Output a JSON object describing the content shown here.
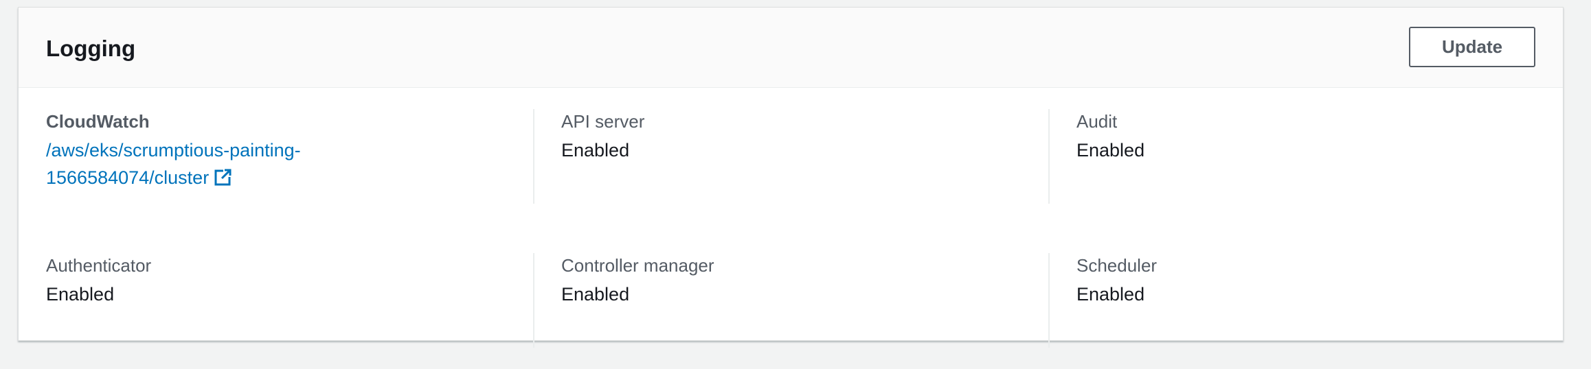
{
  "panel": {
    "title": "Logging",
    "update_label": "Update"
  },
  "colors": {
    "link": "#0073bb",
    "text": "#16191f",
    "label": "#545b64",
    "header_bg": "#fafafa",
    "page_bg": "#f2f3f3"
  },
  "fields": {
    "cloudwatch": {
      "label": "CloudWatch",
      "link_text": "/aws/eks/scrumptious-painting-1566584074/cluster",
      "icon": "external-link-icon"
    },
    "api_server": {
      "label": "API server",
      "value": "Enabled"
    },
    "audit": {
      "label": "Audit",
      "value": "Enabled"
    },
    "authenticator": {
      "label": "Authenticator",
      "value": "Enabled"
    },
    "controller_manager": {
      "label": "Controller manager",
      "value": "Enabled"
    },
    "scheduler": {
      "label": "Scheduler",
      "value": "Enabled"
    }
  }
}
